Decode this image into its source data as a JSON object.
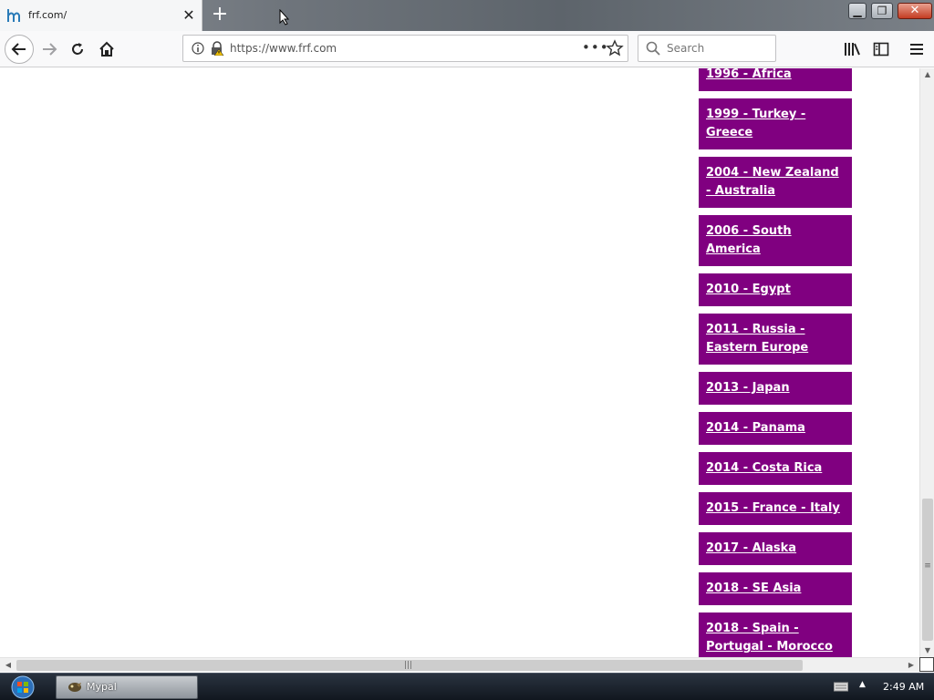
{
  "browser": {
    "tab_title": "frf.com/",
    "url": "https://www.frf.com",
    "search_placeholder": "Search",
    "more_glyph": "•••"
  },
  "page": {
    "trips": [
      "1996 - Africa",
      "1999 - Turkey - Greece",
      "2004 - New Zealand - Australia",
      "2006 - South America",
      "2010 - Egypt",
      "2011 - Russia - Eastern Europe",
      "2013 - Japan",
      "2014 - Panama",
      "2014 - Costa Rica",
      "2015 - France - Italy",
      "2017 - Alaska",
      "2018 - SE Asia",
      "2018 - Spain - Portugal - Morocco"
    ],
    "link_color": "#800080"
  },
  "taskbar": {
    "task_label": "Mypal",
    "clock": "2:49 AM"
  }
}
